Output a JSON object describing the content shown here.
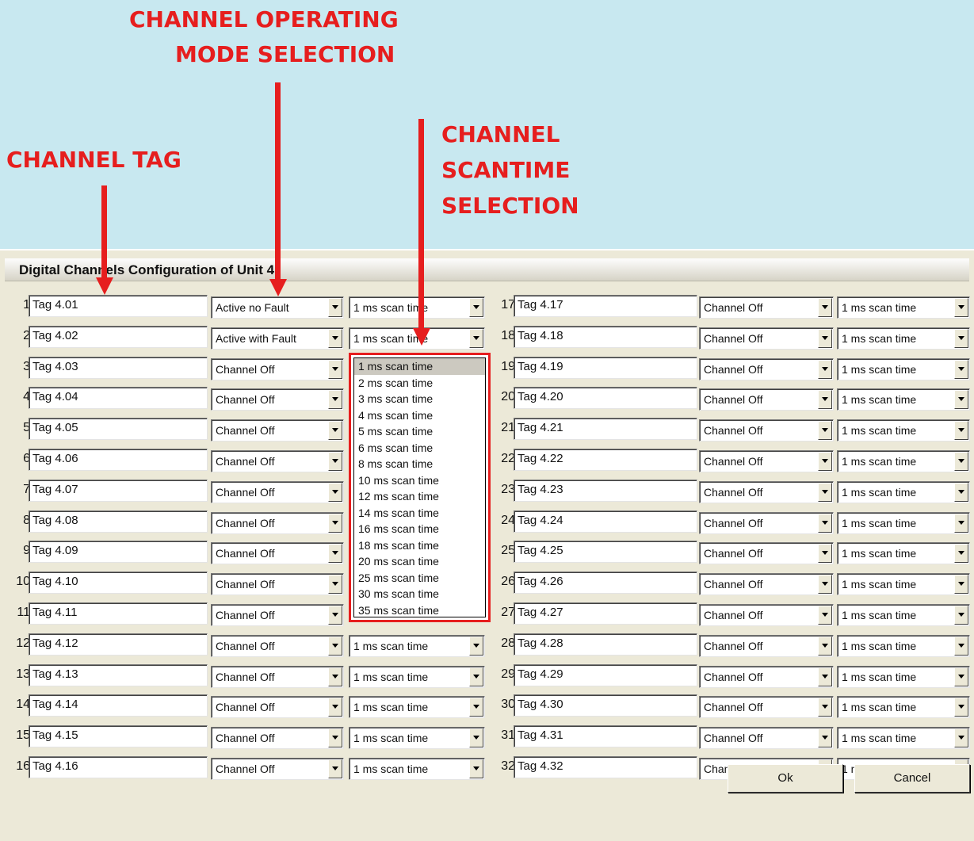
{
  "callouts": {
    "mode_line1": "CHANNEL OPERATING",
    "mode_line2": "MODE SELECTION",
    "tag": "CHANNEL TAG",
    "scan_line1": "CHANNEL",
    "scan_line2": "SCANTIME",
    "scan_line3": "SELECTION"
  },
  "dialog": {
    "title": "Digital Channels Configuration of Unit 4",
    "ok_label": "Ok",
    "cancel_label": "Cancel"
  },
  "left_channels": [
    {
      "num": "1",
      "tag": "Tag 4.01",
      "mode": "Active no Fault",
      "scan": "1 ms scan time"
    },
    {
      "num": "2",
      "tag": "Tag 4.02",
      "mode": "Active with Fault",
      "scan": "1 ms scan time"
    },
    {
      "num": "3",
      "tag": "Tag 4.03",
      "mode": "Channel Off",
      "scan": ""
    },
    {
      "num": "4",
      "tag": "Tag 4.04",
      "mode": "Channel Off",
      "scan": ""
    },
    {
      "num": "5",
      "tag": "Tag 4.05",
      "mode": "Channel Off",
      "scan": ""
    },
    {
      "num": "6",
      "tag": "Tag 4.06",
      "mode": "Channel Off",
      "scan": ""
    },
    {
      "num": "7",
      "tag": "Tag 4.07",
      "mode": "Channel Off",
      "scan": ""
    },
    {
      "num": "8",
      "tag": "Tag 4.08",
      "mode": "Channel Off",
      "scan": ""
    },
    {
      "num": "9",
      "tag": "Tag 4.09",
      "mode": "Channel Off",
      "scan": ""
    },
    {
      "num": "10",
      "tag": "Tag 4.10",
      "mode": "Channel Off",
      "scan": ""
    },
    {
      "num": "11",
      "tag": "Tag 4.11",
      "mode": "Channel Off",
      "scan": ""
    },
    {
      "num": "12",
      "tag": "Tag 4.12",
      "mode": "Channel Off",
      "scan": "1 ms scan time"
    },
    {
      "num": "13",
      "tag": "Tag 4.13",
      "mode": "Channel Off",
      "scan": "1 ms scan time"
    },
    {
      "num": "14",
      "tag": "Tag 4.14",
      "mode": "Channel Off",
      "scan": "1 ms scan time"
    },
    {
      "num": "15",
      "tag": "Tag 4.15",
      "mode": "Channel Off",
      "scan": "1 ms scan time"
    },
    {
      "num": "16",
      "tag": "Tag 4.16",
      "mode": "Channel Off",
      "scan": "1 ms scan time"
    }
  ],
  "right_channels": [
    {
      "num": "17",
      "tag": "Tag 4.17",
      "mode": "Channel Off",
      "scan": "1 ms scan time"
    },
    {
      "num": "18",
      "tag": "Tag 4.18",
      "mode": "Channel Off",
      "scan": "1 ms scan time"
    },
    {
      "num": "19",
      "tag": "Tag 4.19",
      "mode": "Channel Off",
      "scan": "1 ms scan time"
    },
    {
      "num": "20",
      "tag": "Tag 4.20",
      "mode": "Channel Off",
      "scan": "1 ms scan time"
    },
    {
      "num": "21",
      "tag": "Tag 4.21",
      "mode": "Channel Off",
      "scan": "1 ms scan time"
    },
    {
      "num": "22",
      "tag": "Tag 4.22",
      "mode": "Channel Off",
      "scan": "1 ms scan time"
    },
    {
      "num": "23",
      "tag": "Tag 4.23",
      "mode": "Channel Off",
      "scan": "1 ms scan time"
    },
    {
      "num": "24",
      "tag": "Tag 4.24",
      "mode": "Channel Off",
      "scan": "1 ms scan time"
    },
    {
      "num": "25",
      "tag": "Tag 4.25",
      "mode": "Channel Off",
      "scan": "1 ms scan time"
    },
    {
      "num": "26",
      "tag": "Tag 4.26",
      "mode": "Channel Off",
      "scan": "1 ms scan time"
    },
    {
      "num": "27",
      "tag": "Tag 4.27",
      "mode": "Channel Off",
      "scan": "1 ms scan time"
    },
    {
      "num": "28",
      "tag": "Tag 4.28",
      "mode": "Channel Off",
      "scan": "1 ms scan time"
    },
    {
      "num": "29",
      "tag": "Tag 4.29",
      "mode": "Channel Off",
      "scan": "1 ms scan time"
    },
    {
      "num": "30",
      "tag": "Tag 4.30",
      "mode": "Channel Off",
      "scan": "1 ms scan time"
    },
    {
      "num": "31",
      "tag": "Tag 4.31",
      "mode": "Channel Off",
      "scan": "1 ms scan time"
    },
    {
      "num": "32",
      "tag": "Tag 4.32",
      "mode": "Channel Off",
      "scan": "1 ms scan time"
    }
  ],
  "scan_options": [
    "1 ms scan time",
    "2 ms scan time",
    "3 ms scan time",
    "4 ms scan time",
    "5 ms scan time",
    "6 ms scan time",
    "8 ms scan time",
    "10 ms scan time",
    "12 ms scan time",
    "14 ms scan time",
    "16 ms scan time",
    "18 ms scan time",
    "20 ms scan time",
    "25 ms scan time",
    "30 ms scan time",
    "35 ms scan time"
  ],
  "selected_option": "1 ms scan time",
  "colors": {
    "annotation": "#e61e1e",
    "background": "#c8e8f0",
    "dialog": "#ece9d8"
  }
}
